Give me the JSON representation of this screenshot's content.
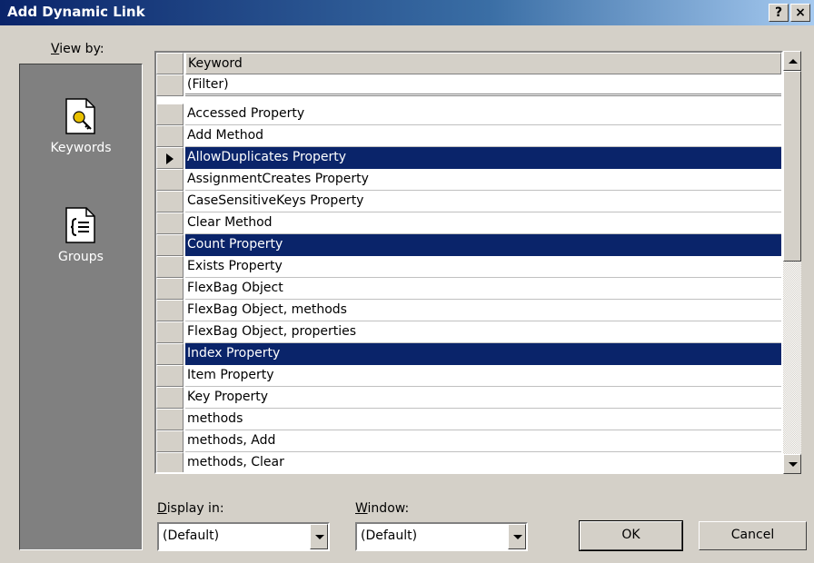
{
  "window": {
    "title": "Add Dynamic Link",
    "help_label": "?",
    "close_label": "×"
  },
  "sidebar": {
    "heading_prefix": "V",
    "heading_rest": "iew by:",
    "items": [
      {
        "label": "Keywords",
        "icon": "key-document-icon"
      },
      {
        "label": "Groups",
        "icon": "braces-document-icon"
      }
    ]
  },
  "grid": {
    "header": "Keyword",
    "filter": "(Filter)",
    "rows": [
      {
        "text": "Accessed Property",
        "selected": false,
        "current": false
      },
      {
        "text": "Add Method",
        "selected": false,
        "current": false
      },
      {
        "text": "AllowDuplicates Property",
        "selected": true,
        "current": true
      },
      {
        "text": "AssignmentCreates Property",
        "selected": false,
        "current": false
      },
      {
        "text": "CaseSensitiveKeys Property",
        "selected": false,
        "current": false
      },
      {
        "text": "Clear Method",
        "selected": false,
        "current": false
      },
      {
        "text": "Count Property",
        "selected": true,
        "current": false
      },
      {
        "text": "Exists Property",
        "selected": false,
        "current": false
      },
      {
        "text": "FlexBag Object",
        "selected": false,
        "current": false
      },
      {
        "text": "FlexBag Object, methods",
        "selected": false,
        "current": false
      },
      {
        "text": "FlexBag Object, properties",
        "selected": false,
        "current": false
      },
      {
        "text": "Index Property",
        "selected": true,
        "current": false
      },
      {
        "text": "Item Property",
        "selected": false,
        "current": false
      },
      {
        "text": "Key Property",
        "selected": false,
        "current": false
      },
      {
        "text": "methods",
        "selected": false,
        "current": false
      },
      {
        "text": "methods, Add",
        "selected": false,
        "current": false
      },
      {
        "text": "methods, Clear",
        "selected": false,
        "current": false
      }
    ]
  },
  "display_in": {
    "prefix": "D",
    "rest": "isplay in:",
    "value": "(Default)"
  },
  "window_select": {
    "prefix": "W",
    "rest": "indow:",
    "value": "(Default)"
  },
  "buttons": {
    "ok": "OK",
    "cancel": "Cancel"
  },
  "colors": {
    "selection": "#0a246a",
    "title_start": "#0a246a",
    "face": "#d4d0c8"
  }
}
